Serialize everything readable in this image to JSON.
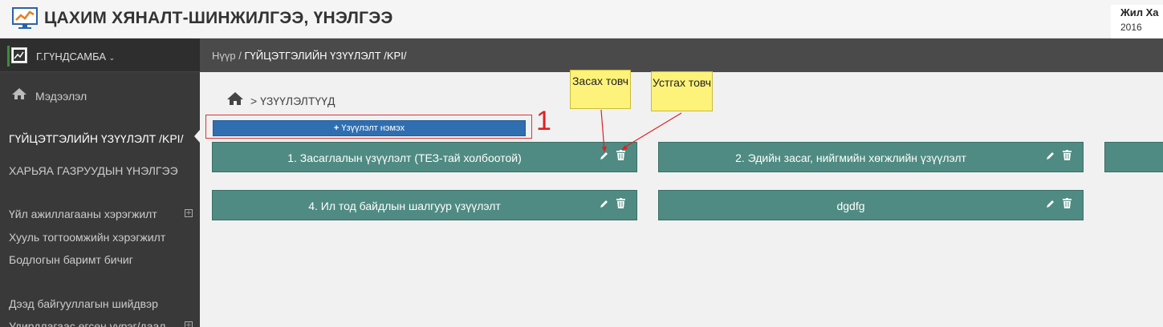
{
  "header": {
    "title": "ЦАХИМ ХЯНАЛТ-ШИНЖИЛГЭЭ, ҮНЭЛГЭЭ",
    "year_label": "Жил  Ха",
    "year_value": "2016"
  },
  "sidebar": {
    "user_name": "Г.ГҮНДСАМБА",
    "items": [
      {
        "label": "Мэдээлэл"
      },
      {
        "label": "ГҮЙЦЭТГЭЛИЙН ҮЗҮҮЛЭЛТ /KPI/"
      },
      {
        "label": "ХАРЬЯА ГАЗРУУДЫН ҮНЭЛГЭЭ"
      },
      {
        "label": "Үйл ажиллагааны хэрэгжилт"
      },
      {
        "label": "Хууль тогтоомжийн хэрэгжилт"
      },
      {
        "label": "Бодлогын баримт бичиг"
      },
      {
        "label": "Дээд байгууллагын шийдвэр"
      },
      {
        "label": "Удирдлагаас өгсөн үүрэг/даал"
      }
    ]
  },
  "breadcrumb": {
    "home": "Нүүр",
    "sep": "/",
    "current": "ГҮЙЦЭТГЭЛИЙН ҮЗҮҮЛЭЛТ /KPI/"
  },
  "main": {
    "section_title": "> ҮЗҮҮЛЭЛТҮҮД",
    "add_button": "Үзүүлэлт нэмэх",
    "marker": "1",
    "cards": [
      {
        "label": "1. Засаглалын үзүүлэлт (ТЕЗ-тай холбоотой)"
      },
      {
        "label": "2. Эдийн засаг, нийгмийн хөгжлийн үзүүлэлт"
      },
      {
        "label": ""
      },
      {
        "label": "4. Ил тод байдлын шалгуур үзүүлэлт"
      },
      {
        "label": "dgdfg"
      }
    ]
  },
  "notes": {
    "edit": "Засах товч",
    "delete": "Устгах товч"
  },
  "colors": {
    "card": "#4f8b82",
    "add_button": "#2f6fb1",
    "highlight": "#dd3333",
    "note": "#fdf27a"
  },
  "icons": [
    "chart-logo-icon",
    "home-icon",
    "pencil-icon",
    "trash-icon",
    "plus-icon",
    "plus-square-icon",
    "chevron-down-icon"
  ]
}
